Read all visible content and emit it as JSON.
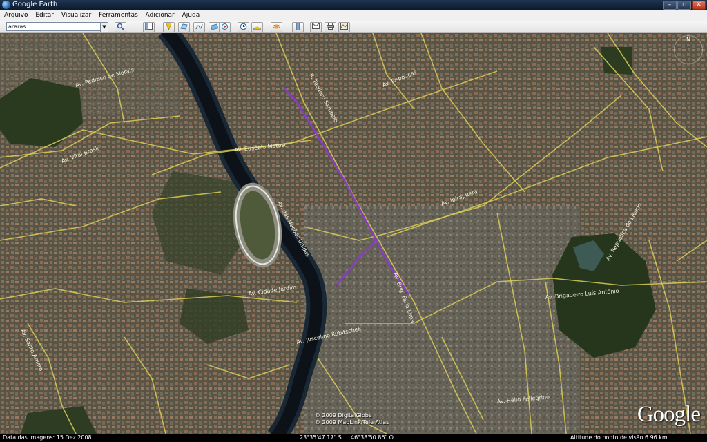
{
  "window": {
    "title": "Google Earth",
    "buttons": [
      "–",
      "▫",
      "✕"
    ]
  },
  "menu": [
    "Arquivo",
    "Editar",
    "Visualizar",
    "Ferramentas",
    "Adicionar",
    "Ajuda"
  ],
  "toolbar": {
    "search_value": "araras",
    "buttons": [
      "search-icon",
      "sidebar-icon",
      "placemark-icon",
      "polygon-icon",
      "path-icon",
      "overlay-icon",
      "tour-icon",
      "history-icon",
      "sun-icon",
      "planets-icon",
      "ruler-icon",
      "email-icon",
      "print-icon",
      "maps-icon"
    ]
  },
  "map": {
    "compass_label": "N",
    "road_labels": [
      "Av. Eusébio Matoso",
      "R. Teodoro Sampaio",
      "Av. das Nações Unidas",
      "Av. Brig. Faria Lima",
      "Av. Rebouças",
      "Av. Cidade Jardim",
      "Av. Juscelino Kubitschek",
      "Av. Brigadeiro Luís Antônio",
      "Av. Vital Brasil",
      "Av. Pedroso de Morais",
      "Av. Santo Amaro",
      "Av. Ibirapuera",
      "Av. República do Líbano",
      "Av. Hélio Pellegrino"
    ],
    "route_color": "#8a3cc8",
    "road_color": "#d9cf55",
    "river_color": "#1a2836",
    "copyright": [
      "© 2009 DigitalGlobe",
      "© 2009 MapLink/Tele Atlas"
    ],
    "logo": "Google"
  },
  "status": {
    "date": "Data das imagens: 15 Dez 2008",
    "lat": "23°35'47.17\" S",
    "lon": "46°38'50.86\" O",
    "altitude": "Altitude do ponto de visão    6.96 km"
  }
}
